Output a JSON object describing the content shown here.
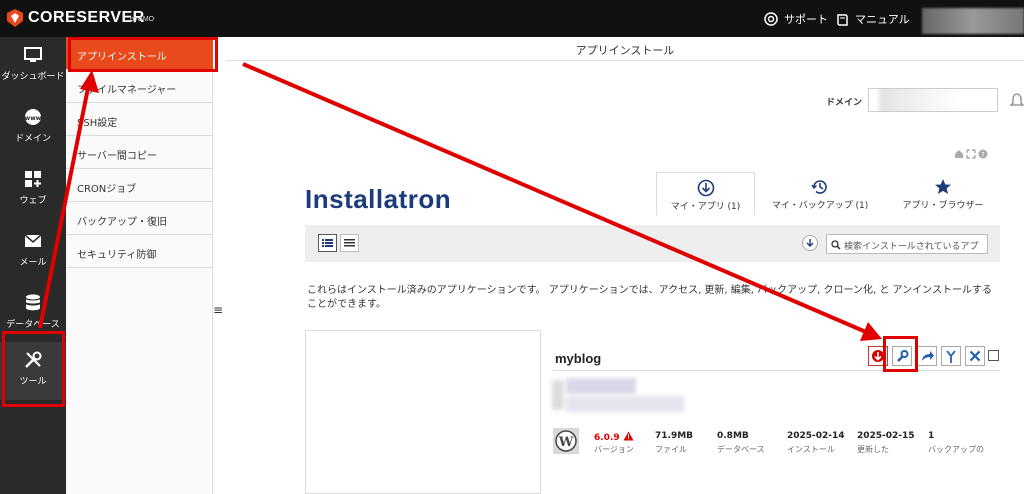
{
  "topbar": {
    "brand": "CORESERVER",
    "brand_sub": "byGMO",
    "support_label": "サポート",
    "manual_label": "マニュアル"
  },
  "leftnav": {
    "items": [
      {
        "label": "ダッシュボード",
        "icon": "monitor-icon"
      },
      {
        "label": "ドメイン",
        "icon": "www-icon"
      },
      {
        "label": "ウェブ",
        "icon": "grid-plus-icon"
      },
      {
        "label": "メール",
        "icon": "envelope-icon"
      },
      {
        "label": "データベース",
        "icon": "database-icon"
      },
      {
        "label": "ツール",
        "icon": "tools-icon"
      }
    ],
    "active_index": 5
  },
  "submenu": {
    "items": [
      {
        "label": "アプリインストール"
      },
      {
        "label": "ファイルマネージャー"
      },
      {
        "label": "SSH設定"
      },
      {
        "label": "サーバー間コピー"
      },
      {
        "label": "CRONジョブ"
      },
      {
        "label": "バックアップ・復旧"
      },
      {
        "label": "セキュリティ防御"
      }
    ],
    "active_index": 0
  },
  "main": {
    "title": "アプリインストール",
    "domain_label": "ドメイン",
    "logo_text": "Installatron",
    "tabs": [
      {
        "label": "マイ・アプリ (1)",
        "icon": "download-circle-icon"
      },
      {
        "label": "マイ・バックアップ (1)",
        "icon": "history-icon"
      },
      {
        "label": "アプリ・ブラウザー",
        "icon": "star-icon"
      }
    ],
    "search_placeholder": "検索インストールされているアプ",
    "description": "これらはインストール済みのアプリケーションです。 アプリケーションでは、アクセス, 更新, 編集, バックアップ, クローン化, と アンインストールすることができます。"
  },
  "app": {
    "name": "myblog",
    "stats": [
      {
        "value": "6.0.9",
        "label": "バージョン",
        "warn": true
      },
      {
        "value": "71.9MB",
        "label": "ファイル"
      },
      {
        "value": "0.8MB",
        "label": "データベース"
      },
      {
        "value": "2025-02-14",
        "label": "インストール"
      },
      {
        "value": "2025-02-15",
        "label": "更新した"
      },
      {
        "value": "1",
        "label": "バックアップの"
      }
    ]
  },
  "colors": {
    "accent": "#e94a1b",
    "annotation_red": "#e10000",
    "installatron_blue": "#1b3b7a",
    "action_blue": "#1f5fb0"
  }
}
